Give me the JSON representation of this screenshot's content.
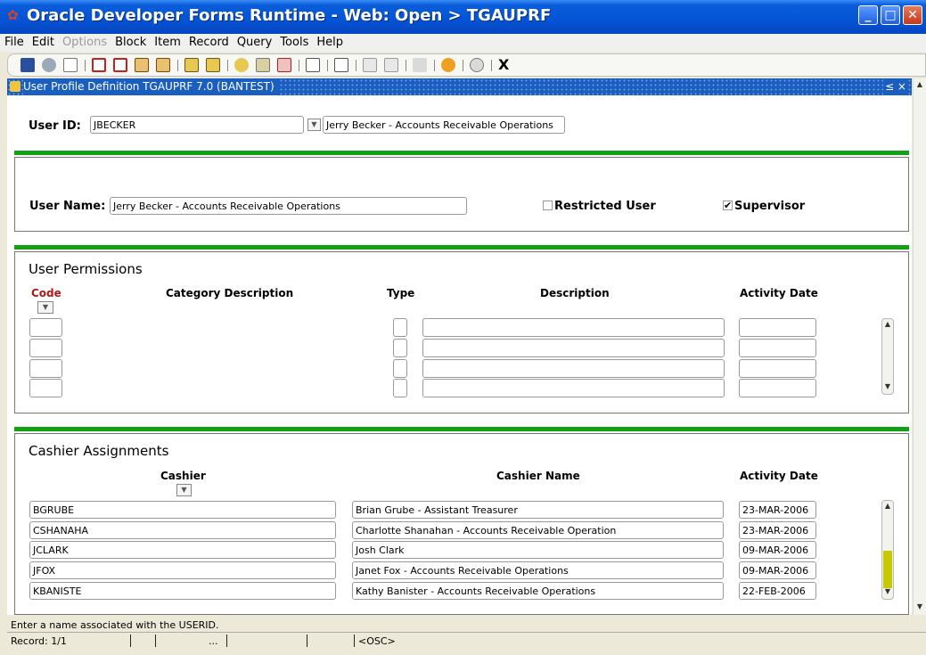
{
  "window": {
    "title": "Oracle Developer Forms Runtime - Web:  Open > TGAUPRF"
  },
  "menu": [
    "File",
    "Edit",
    "Options",
    "Block",
    "Item",
    "Record",
    "Query",
    "Tools",
    "Help"
  ],
  "toolbar": {
    "exit_label": "X"
  },
  "form": {
    "title": "User Profile Definition  TGAUPRF  7.0  (BANTEST)",
    "controls": "≤ ×"
  },
  "key_block": {
    "user_id_label": "User ID:",
    "user_id_value": "JBECKER",
    "user_description": "Jerry Becker - Accounts Receivable Operations"
  },
  "user_block": {
    "user_name_label": "User Name:",
    "user_name_value": "Jerry Becker - Accounts Receivable Operations",
    "restricted_label": "Restricted User",
    "restricted_checked": false,
    "supervisor_label": "Supervisor",
    "supervisor_checked": true
  },
  "permissions": {
    "title": "User Permissions",
    "columns": {
      "code": "Code",
      "category": "Category Description",
      "type": "Type",
      "description": "Description",
      "activity_date": "Activity Date"
    }
  },
  "cashier": {
    "title": "Cashier Assignments",
    "columns": {
      "cashier": "Cashier",
      "name": "Cashier Name",
      "activity_date": "Activity Date"
    },
    "rows": [
      {
        "cashier": "BGRUBE",
        "name": "Brian Grube - Assistant Treasurer",
        "date": "23-MAR-2006"
      },
      {
        "cashier": "CSHANAHA",
        "name": "Charlotte Shanahan - Accounts Receivable Operation",
        "date": "23-MAR-2006"
      },
      {
        "cashier": "JCLARK",
        "name": "Josh Clark",
        "date": "09-MAR-2006"
      },
      {
        "cashier": "JFOX",
        "name": "Janet Fox - Accounts Receivable Operations",
        "date": "09-MAR-2006"
      },
      {
        "cashier": "KBANISTE",
        "name": "Kathy Banister - Accounts Receivable Operations",
        "date": "22-FEB-2006"
      }
    ]
  },
  "status": {
    "message": "Enter a name associated with the USERID.",
    "record": "Record: 1/1",
    "ellipsis": "...",
    "mode": "<OSC>"
  },
  "colors": {
    "titlebar": "#0A5DD9",
    "accent_green": "#14A014",
    "form_title": "#1A5EC0",
    "code_label": "#B01818"
  }
}
